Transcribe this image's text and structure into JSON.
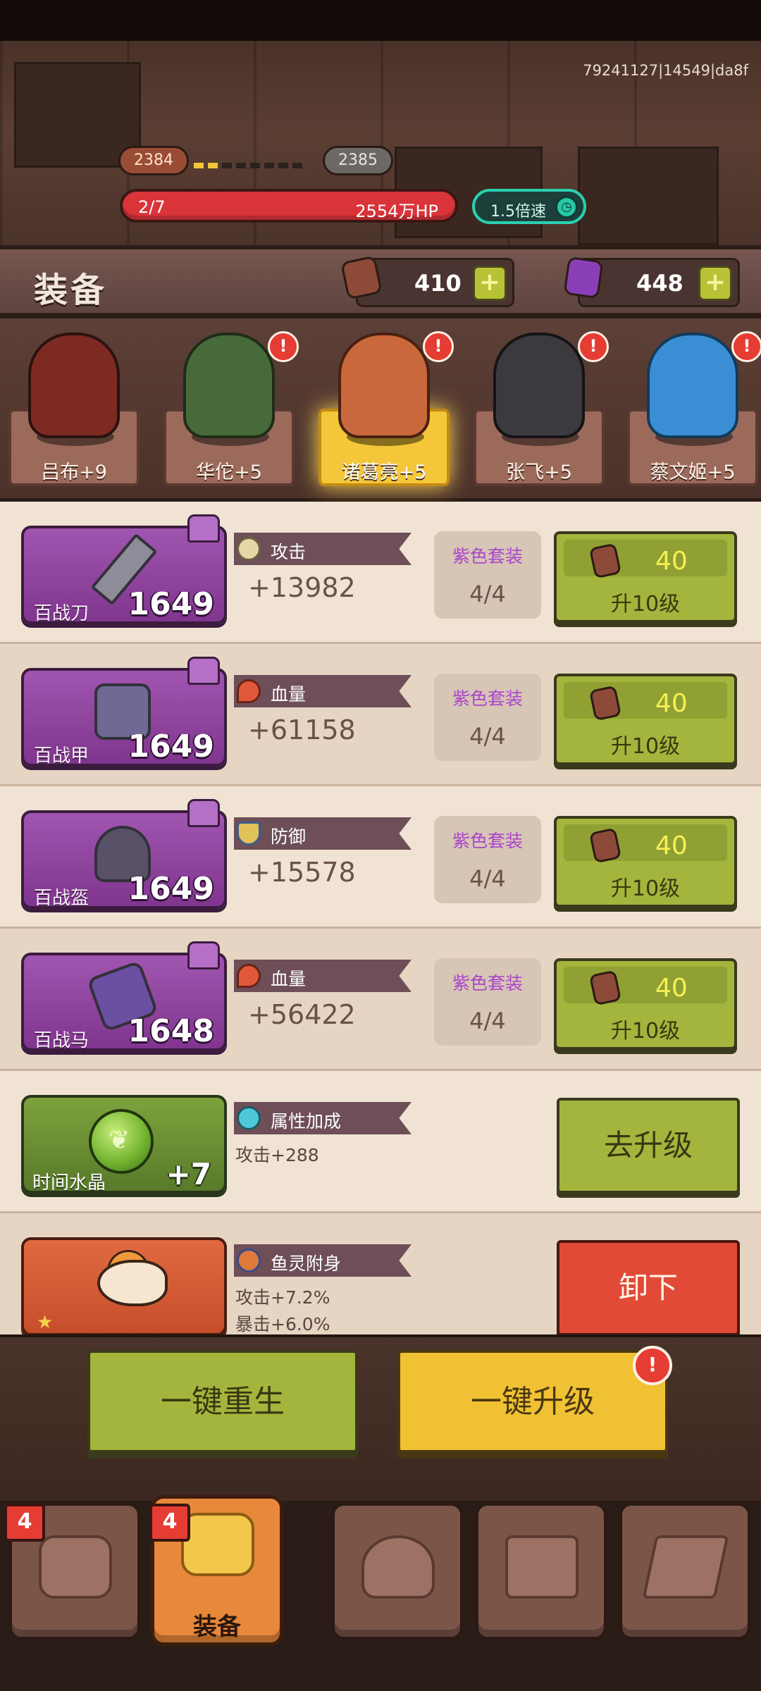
{
  "build_id": "79241127|14549|da8f",
  "progress": {
    "current_level": "2384",
    "next_level": "2385",
    "dots_filled": 2,
    "dots_total": 8
  },
  "hp_bar": {
    "wave": "2/7",
    "hp_text": "2554万HP"
  },
  "speed_button": {
    "label": "1.5倍速"
  },
  "section_title": "装备",
  "resources": {
    "wood": "410",
    "crystal": "448",
    "plus": "+"
  },
  "heroes": [
    {
      "name": "吕布+9",
      "badge": ""
    },
    {
      "name": "华佗+5",
      "badge": "!"
    },
    {
      "name": "诸葛亮+5",
      "badge": "!",
      "active": true
    },
    {
      "name": "张飞+5",
      "badge": "!"
    },
    {
      "name": "蔡文姬+5",
      "badge": "!"
    }
  ],
  "equipment": [
    {
      "name": "百战刀",
      "level": "1649",
      "stat_name": "攻击",
      "stat_value": "+13982",
      "set_name": "紫色套装",
      "set_count": "4/4",
      "cost": "40",
      "upgrade_label": "升10级"
    },
    {
      "name": "百战甲",
      "level": "1649",
      "stat_name": "血量",
      "stat_value": "+61158",
      "set_name": "紫色套装",
      "set_count": "4/4",
      "cost": "40",
      "upgrade_label": "升10级"
    },
    {
      "name": "百战盔",
      "level": "1649",
      "stat_name": "防御",
      "stat_value": "+15578",
      "set_name": "紫色套装",
      "set_count": "4/4",
      "cost": "40",
      "upgrade_label": "升10级"
    },
    {
      "name": "百战马",
      "level": "1648",
      "stat_name": "血量",
      "stat_value": "+56422",
      "set_name": "紫色套装",
      "set_count": "4/4",
      "cost": "40",
      "upgrade_label": "升10级"
    }
  ],
  "time_crystal": {
    "name": "时间水晶",
    "plus": "+7",
    "stat_name": "属性加成",
    "stat_value": "攻击+288",
    "button": "去升级"
  },
  "fish_spirit": {
    "stat_name": "鱼灵附身",
    "line1": "攻击+7.2%",
    "line2": "暴击+6.0%",
    "button": "卸下"
  },
  "actions": {
    "rebirth": "一键重生",
    "upgrade_all": "一键升级",
    "upgrade_all_alert": "!"
  },
  "nav": {
    "tabs": [
      {
        "id": "hero",
        "label": "",
        "badge": "4"
      },
      {
        "id": "equip",
        "label": "装备",
        "badge": "4",
        "active": true
      },
      {
        "id": "smith",
        "label": "",
        "badge": ""
      },
      {
        "id": "chest",
        "label": "",
        "badge": ""
      },
      {
        "id": "scroll",
        "label": "",
        "badge": ""
      }
    ]
  },
  "colors": {
    "purple_set": "#a946c9",
    "green_button": "#a3b53c",
    "red_button": "#e04a37",
    "gold_button": "#f0c233"
  }
}
